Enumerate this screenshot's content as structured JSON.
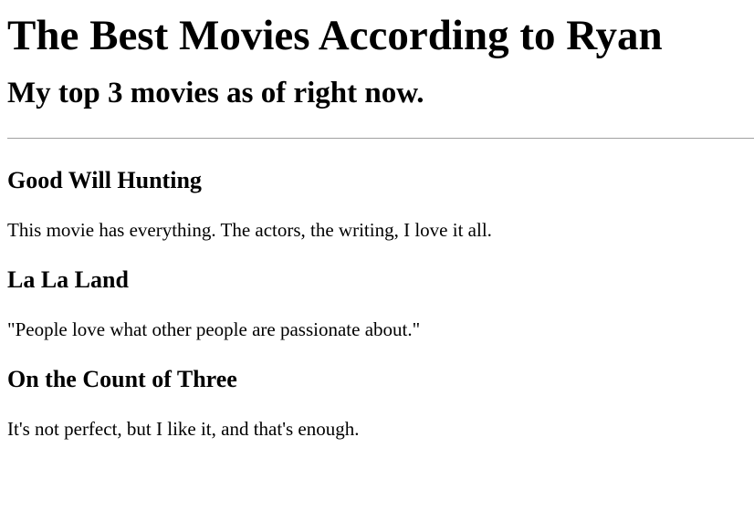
{
  "header": {
    "title": "The Best Movies According to Ryan",
    "subtitle": "My top 3 movies as of right now."
  },
  "movies": [
    {
      "title": "Good Will Hunting",
      "description": "This movie has everything. The actors, the writing, I love it all."
    },
    {
      "title": "La La Land",
      "description": "\"People love what other people are passionate about.\""
    },
    {
      "title": "On the Count of Three",
      "description": "It's not perfect, but I like it, and that's enough."
    }
  ]
}
